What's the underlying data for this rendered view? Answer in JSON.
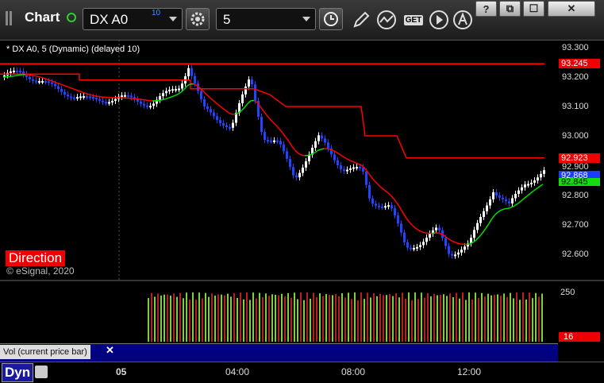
{
  "toolbar": {
    "title": "Chart",
    "symbol": "DX A0",
    "symbol_superscript": "10",
    "interval": "5",
    "get_label": "GET"
  },
  "window_buttons": {
    "help": "?",
    "restore": "⧉",
    "maximize": "☐",
    "close": "✕"
  },
  "chart": {
    "legend": "* DX A0, 5 (Dynamic) (delayed 10)",
    "direction_label": "Direction",
    "copyright": "© eSignal, 2020",
    "price_ticks": [
      "93.300",
      "93.200",
      "93.100",
      "93.000",
      "92.900",
      "92.800",
      "92.700",
      "92.600"
    ],
    "price_tags": {
      "red_upper": "93.245",
      "red_lower": "92.923",
      "last_price": "92.868",
      "green": "92.845"
    },
    "colors": {
      "up_candle": "#ffffff",
      "down_candle": "#2244ff",
      "upper_line": "#ff0000",
      "ma_red": "#ff0000",
      "ma_green": "#00dd00",
      "volume_up": "#7fcf3f",
      "volume_down": "#b82020"
    }
  },
  "volume": {
    "axis_label": "250",
    "current_tag": "16",
    "subpane_label": "Vol (current price bar)",
    "close_glyph": "✕"
  },
  "time_axis": {
    "mode_label": "Dyn",
    "ticks": [
      "05",
      "04:00",
      "08:00",
      "12:00"
    ]
  }
}
